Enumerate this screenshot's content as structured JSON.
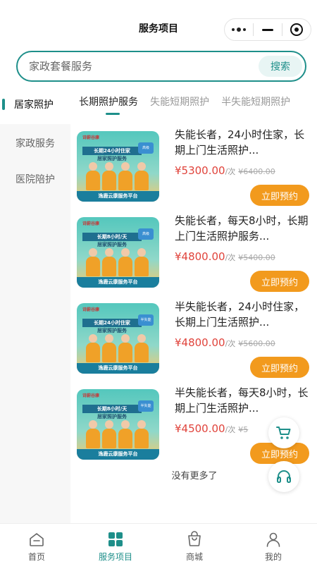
{
  "header": {
    "title": "服务项目",
    "capsule": {
      "more_icon": "more-dots-icon",
      "minimize_icon": "minimize-icon",
      "close_icon": "target-icon"
    }
  },
  "search": {
    "placeholder": "家政套餐服务",
    "button_label": "搜索"
  },
  "categories": {
    "current": "居家照护",
    "tabs": [
      {
        "label": "长期照护服务",
        "active": true
      },
      {
        "label": "失能短期照护",
        "active": false
      },
      {
        "label": "半失能短期照护",
        "active": false
      }
    ]
  },
  "sidebar": {
    "items": [
      {
        "label": "家政服务"
      },
      {
        "label": "医院陪护"
      }
    ]
  },
  "products": [
    {
      "title": "失能长者，24小时住家，长期上门生活照护...",
      "price": "¥5300.00",
      "unit": "/次",
      "original_price": "¥6400.00",
      "button": "立即预约",
      "image": {
        "brand": "诗蔚谷康",
        "banner_line1": "长期24小时住家",
        "banner_line2": "居家照护服务",
        "seal": "高级",
        "footer": "逸鹿云康服务平台"
      }
    },
    {
      "title": "失能长者，每天8小时，长期上门生活照护服务...",
      "price": "¥4800.00",
      "unit": "/次",
      "original_price": "¥5400.00",
      "button": "立即预约",
      "image": {
        "brand": "诗蔚谷康",
        "banner_line1": "长期8小时/天",
        "banner_line2": "居家照护服务",
        "seal": "高级",
        "footer": "逸鹿云康服务平台"
      }
    },
    {
      "title": "半失能长者，24小时住家，长期上门生活照护...",
      "price": "¥4800.00",
      "unit": "/次",
      "original_price": "¥5600.00",
      "button": "立即预约",
      "image": {
        "brand": "诗蔚谷康",
        "banner_line1": "长期24小时住家",
        "banner_line2": "居家照护服务",
        "seal": "半失能",
        "footer": "逸鹿云康服务平台"
      }
    },
    {
      "title": "半失能长者，每天8小时，长期上门生活照护...",
      "price": "¥4500.00",
      "unit": "/次",
      "original_price": "¥5",
      "button": "立即预约",
      "image": {
        "brand": "诗蔚谷康",
        "banner_line1": "长期8小时/天",
        "banner_line2": "居家照护服务",
        "seal": "半失能",
        "footer": "逸鹿云康服务平台"
      }
    }
  ],
  "list_end_text": "没有更多了",
  "floating": {
    "cart_icon": "cart-icon",
    "support_icon": "headset-icon"
  },
  "bottom_nav": [
    {
      "label": "首页",
      "icon": "home-icon",
      "active": false
    },
    {
      "label": "服务项目",
      "icon": "grid-icon",
      "active": true
    },
    {
      "label": "商城",
      "icon": "shop-bag-icon",
      "active": false
    },
    {
      "label": "我的",
      "icon": "user-icon",
      "active": false
    }
  ],
  "colors": {
    "accent": "#1e8f8a",
    "price": "#e0433b",
    "cta": "#f29a1d"
  }
}
